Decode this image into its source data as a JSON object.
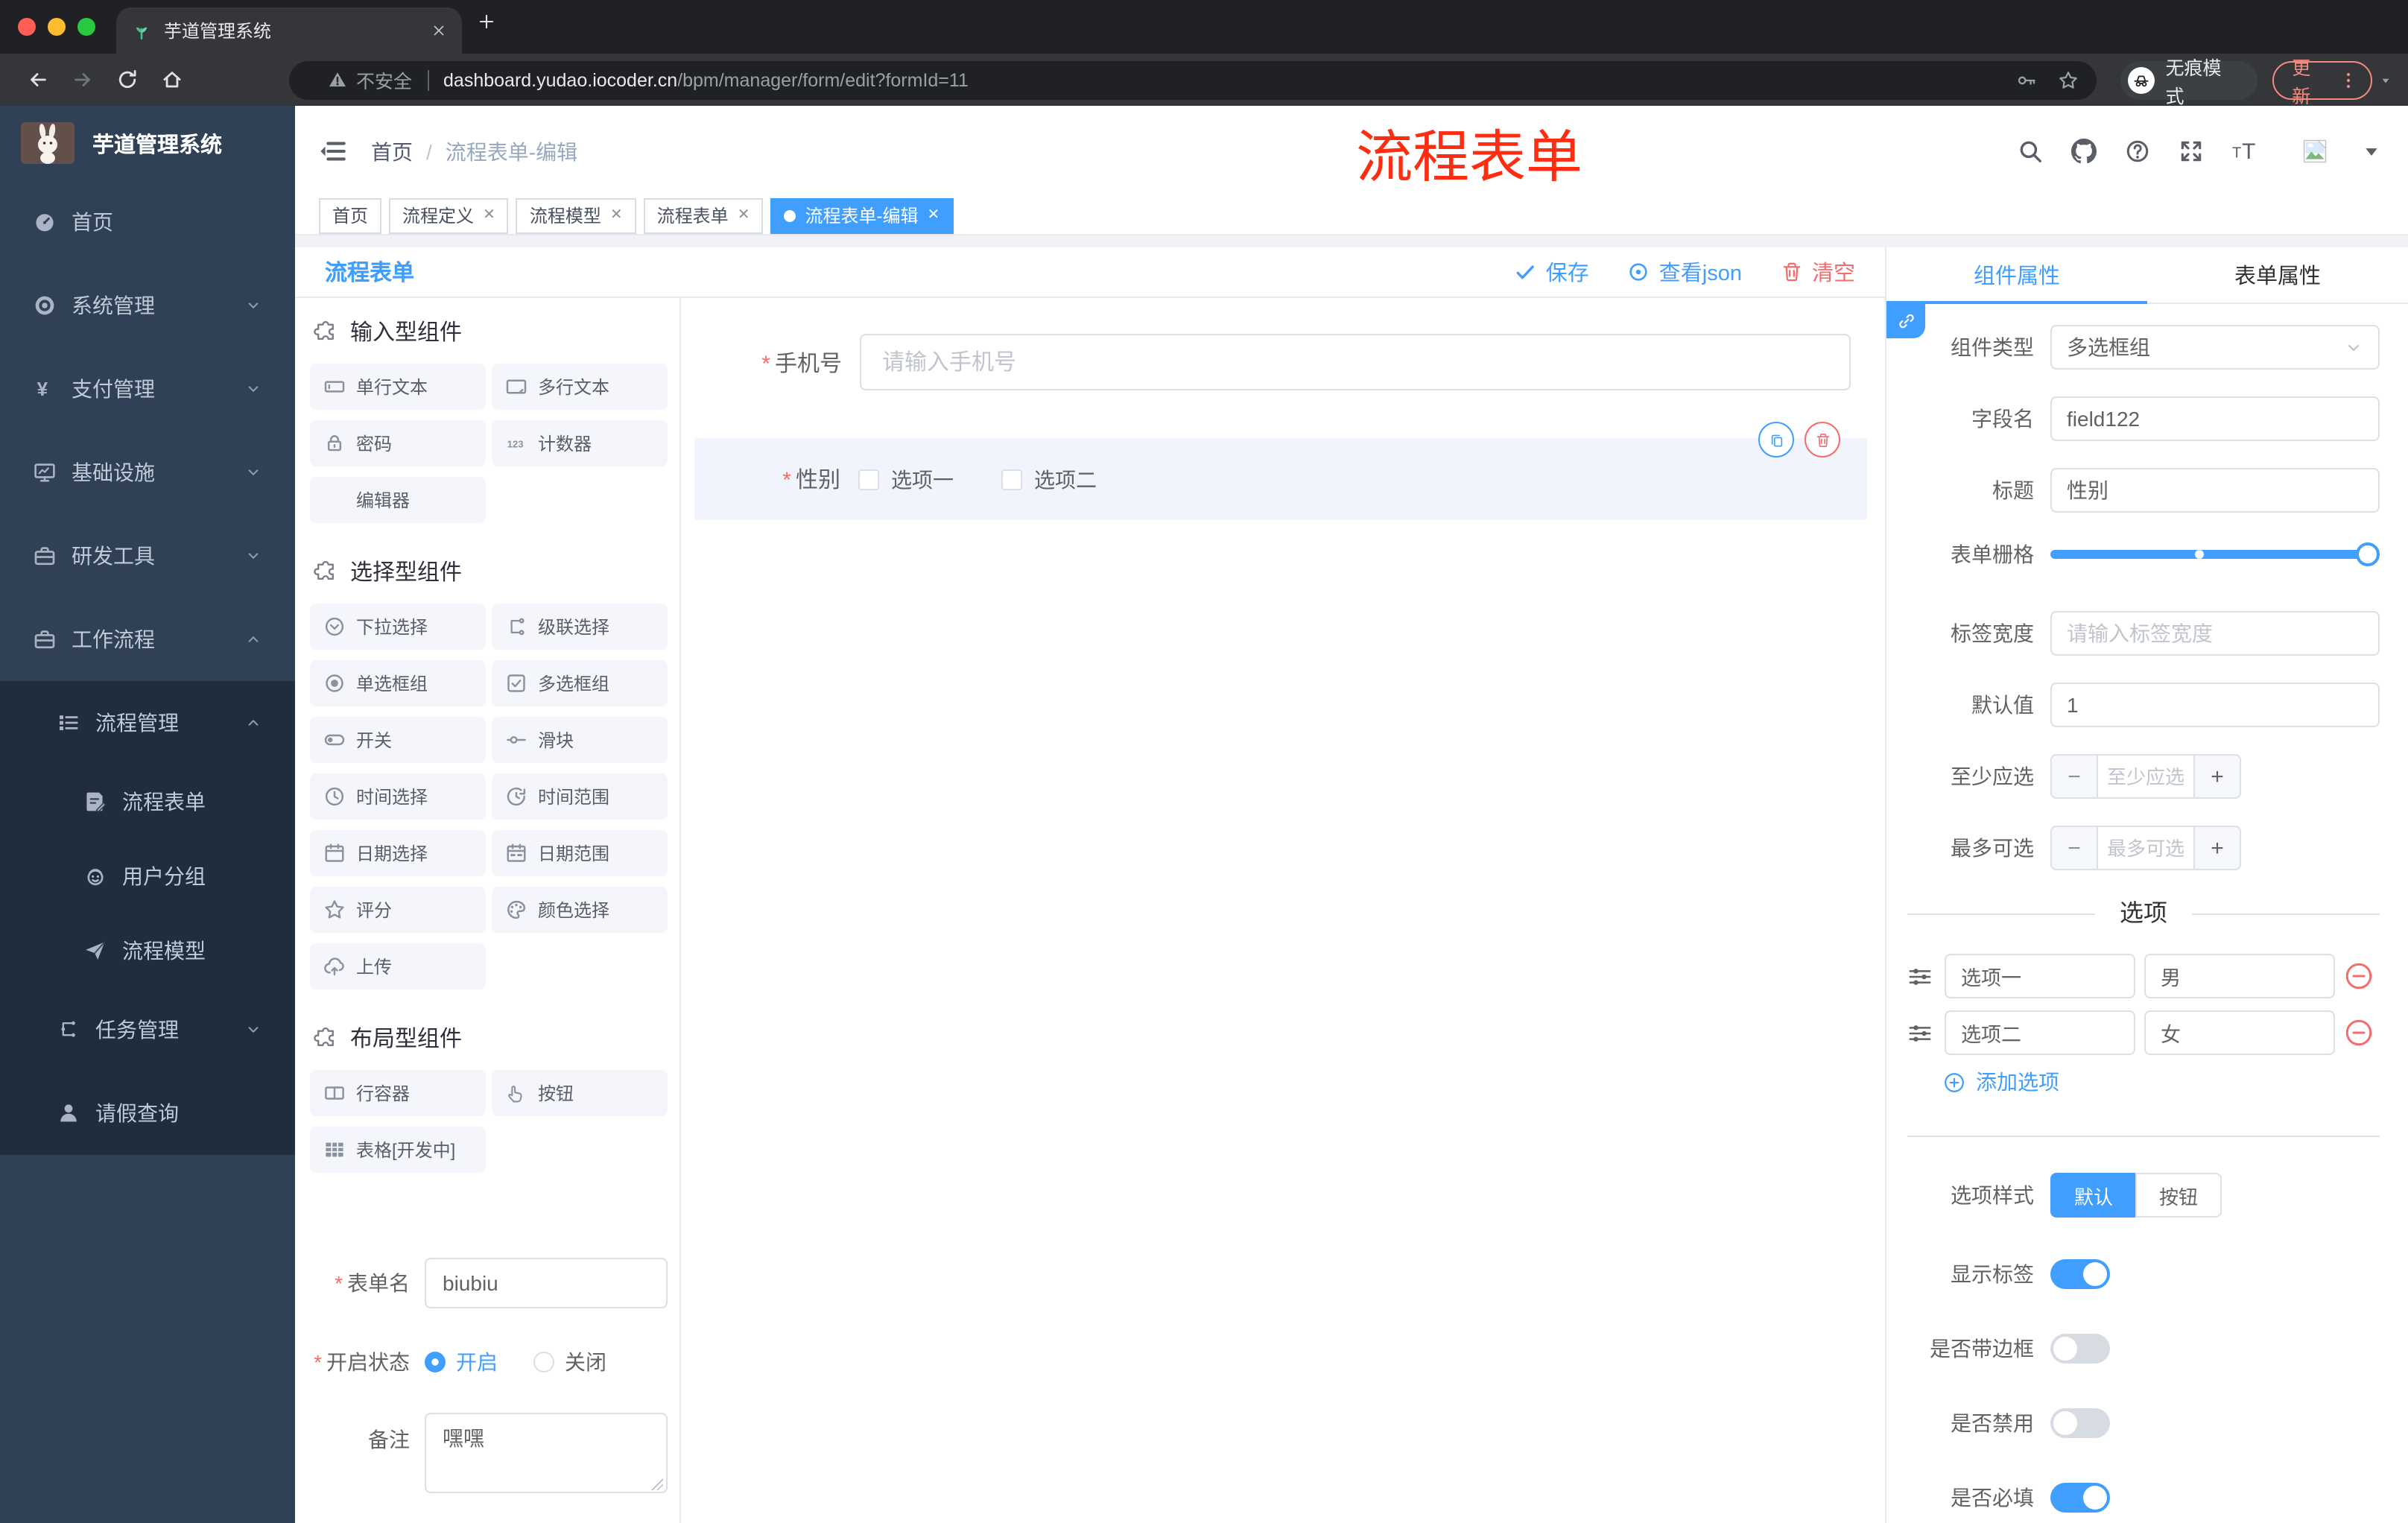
{
  "colors": {
    "accent": "#409eff",
    "danger": "#f56c6c",
    "annotation_red": "#fe2c10",
    "sidebar_bg": "#304156",
    "submenu_bg": "#1f2d3d",
    "sidebar_text": "#bfcbd9",
    "chrome_dark": "#202124",
    "chrome_mid": "#35363a",
    "update_red": "#f28b82",
    "traffic_red": "#ff5f57",
    "traffic_yellow": "#febc2e",
    "traffic_green": "#28c840"
  },
  "browser": {
    "tab_title": "芋道管理系统",
    "security_label": "不安全",
    "url_host": "dashboard.yudao.iocoder.cn",
    "url_path": "/bpm/manager/form/edit?formId=11",
    "incognito_label": "无痕模式",
    "update_label": "更新"
  },
  "sidebar": {
    "logo_title": "芋道管理系统",
    "items": [
      {
        "label": "首页",
        "icon": "dashboard-icon",
        "level": 1,
        "chevron": null,
        "submenu": false
      },
      {
        "label": "系统管理",
        "icon": "gear-icon",
        "level": 1,
        "chevron": "down",
        "submenu": false
      },
      {
        "label": "支付管理",
        "icon": "yen-icon",
        "level": 1,
        "chevron": "down",
        "submenu": false
      },
      {
        "label": "基础设施",
        "icon": "monitor-icon",
        "level": 1,
        "chevron": "down",
        "submenu": false
      },
      {
        "label": "研发工具",
        "icon": "briefcase-icon",
        "level": 1,
        "chevron": "down",
        "submenu": false
      },
      {
        "label": "工作流程",
        "icon": "briefcase-icon",
        "level": 1,
        "chevron": "up",
        "submenu": false
      },
      {
        "label": "流程管理",
        "icon": "list-tree-icon",
        "level": 2,
        "ch evron": null,
        "chevron": "up",
        "submenu": true
      },
      {
        "label": "流程表单",
        "icon": "doc-edit-icon",
        "level": 3,
        "chevron": null,
        "submenu": true
      },
      {
        "label": "用户分组",
        "icon": "robot-icon",
        "level": 3,
        "chevron": null,
        "submenu": true
      },
      {
        "label": "流程模型",
        "icon": "paper-plane-icon",
        "level": 3,
        "chevron": null,
        "submenu": true
      },
      {
        "label": "任务管理",
        "icon": "branch-icon",
        "level": 2,
        "chevron": "down",
        "submenu": true
      },
      {
        "label": "请假查询",
        "icon": "user-icon",
        "level": 2,
        "chevron": null,
        "submenu": true
      }
    ]
  },
  "navbar": {
    "breadcrumb": [
      "首页",
      "流程表单-编辑"
    ],
    "annotation": "流程表单"
  },
  "tags": [
    {
      "label": "首页",
      "closable": false,
      "active": false
    },
    {
      "label": "流程定义",
      "closable": true,
      "active": false
    },
    {
      "label": "流程模型",
      "closable": true,
      "active": false
    },
    {
      "label": "流程表单",
      "closable": true,
      "active": false
    },
    {
      "label": "流程表单-编辑",
      "closable": true,
      "active": true
    }
  ],
  "toolbar": {
    "title": "流程表单",
    "save": "保存",
    "view_json": "查看json",
    "clear": "清空"
  },
  "palette": {
    "sections": [
      {
        "title": "输入型组件",
        "items": [
          {
            "icon": "input-icon",
            "label": "单行文本"
          },
          {
            "icon": "textarea-icon",
            "label": "多行文本"
          },
          {
            "icon": "lock-icon",
            "label": "密码"
          },
          {
            "icon": "counter-icon",
            "label": "计数器"
          },
          {
            "icon": null,
            "label": "编辑器"
          }
        ]
      },
      {
        "title": "选择型组件",
        "items": [
          {
            "icon": "select-icon",
            "label": "下拉选择"
          },
          {
            "icon": "cascader-icon",
            "label": "级联选择"
          },
          {
            "icon": "radio-icon",
            "label": "单选框组"
          },
          {
            "icon": "checkbox-icon",
            "label": "多选框组"
          },
          {
            "icon": "switch-icon",
            "label": "开关"
          },
          {
            "icon": "slider-icon",
            "label": "滑块"
          },
          {
            "icon": "time-icon",
            "label": "时间选择"
          },
          {
            "icon": "time-range-icon",
            "label": "时间范围"
          },
          {
            "icon": "date-icon",
            "label": "日期选择"
          },
          {
            "icon": "date-range-icon",
            "label": "日期范围"
          },
          {
            "icon": "star-icon",
            "label": "评分"
          },
          {
            "icon": "palette-icon",
            "label": "颜色选择"
          },
          {
            "icon": "upload-icon",
            "label": "上传"
          }
        ]
      },
      {
        "title": "布局型组件",
        "items": [
          {
            "icon": "row-icon",
            "label": "行容器"
          },
          {
            "icon": "hand-icon",
            "label": "按钮"
          },
          {
            "icon": "table-icon",
            "label": "表格[开发中]"
          }
        ]
      }
    ]
  },
  "left_form": {
    "name_label": "表单名",
    "name_value": "biubiu",
    "status_label": "开启状态",
    "status_on": "开启",
    "status_off": "关闭",
    "remark_label": "备注",
    "remark_value": "嘿嘿"
  },
  "canvas": {
    "phone": {
      "label": "手机号",
      "placeholder": "请输入手机号"
    },
    "gender": {
      "label": "性别",
      "options": [
        "选项一",
        "选项二"
      ]
    }
  },
  "panel": {
    "tabs": [
      "组件属性",
      "表单属性"
    ],
    "component_type": {
      "label": "组件类型",
      "value": "多选框组"
    },
    "field_name": {
      "label": "字段名",
      "value": "field122"
    },
    "title_field": {
      "label": "标题",
      "value": "性别"
    },
    "grid": {
      "label": "表单栅格"
    },
    "label_width": {
      "label": "标签宽度",
      "placeholder": "请输入标签宽度"
    },
    "default_value": {
      "label": "默认值",
      "value": "1"
    },
    "min_select": {
      "label": "至少应选",
      "placeholder": "至少应选"
    },
    "max_select": {
      "label": "最多可选",
      "placeholder": "最多可选"
    },
    "options_title": "选项",
    "options": [
      {
        "name": "选项一",
        "value": "男"
      },
      {
        "name": "选项二",
        "value": "女"
      }
    ],
    "add_option": "添加选项",
    "style": {
      "label": "选项样式",
      "options": [
        "默认",
        "按钮"
      ],
      "active": 0
    },
    "switches": [
      {
        "label": "显示标签",
        "on": true
      },
      {
        "label": "是否带边框",
        "on": false
      },
      {
        "label": "是否禁用",
        "on": false
      },
      {
        "label": "是否必填",
        "on": true
      }
    ]
  }
}
